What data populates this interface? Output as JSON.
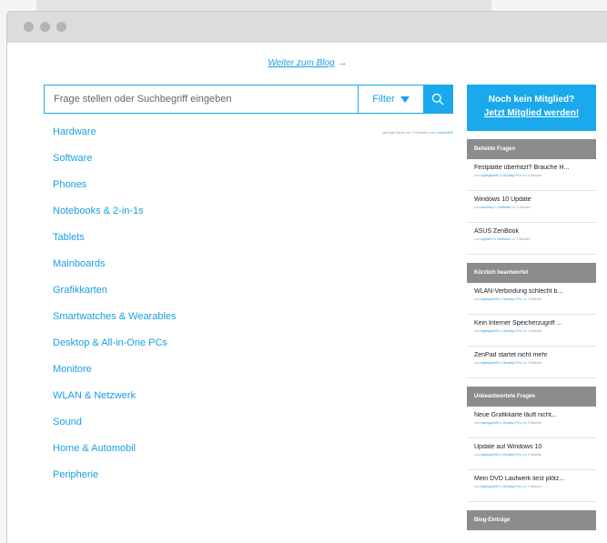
{
  "blog_link": "Weiter zum Blog",
  "search": {
    "placeholder": "Frage stellen oder Suchbegriff eingeben",
    "filter_label": "Filter"
  },
  "categories": [
    {
      "label": "Hardware",
      "meta_prefix": "gefragt Heute vor 3 Stunden von",
      "meta_user": "Louis1805"
    },
    {
      "label": "Software"
    },
    {
      "label": "Phones"
    },
    {
      "label": "Notebooks & 2-in-1s"
    },
    {
      "label": "Tablets"
    },
    {
      "label": "Mainboards"
    },
    {
      "label": "Grafikkarten"
    },
    {
      "label": "Smartwatches & Wearables"
    },
    {
      "label": "Desktop & All-in-One PCs"
    },
    {
      "label": "Monitore"
    },
    {
      "label": "WLAN & Netzwerk"
    },
    {
      "label": "Sound"
    },
    {
      "label": "Home & Automobil"
    },
    {
      "label": "Peripherie"
    }
  ],
  "sidebar": {
    "cta_title": "Noch kein Mitglied?",
    "cta_link": "Jetzt Mitglied werden!",
    "sections": [
      {
        "title": "Beliebte Fragen",
        "items": [
          {
            "q": "Festplatte überhitzt? Brauche H...",
            "by": "von",
            "user": "ostperguin55",
            "in": "in",
            "cat": "Desktop PCs",
            "time": "vor 3 Minuten"
          },
          {
            "q": "Windows 10 Update",
            "by": "von",
            "user": "pavShery",
            "in": "in",
            "cat": "Software",
            "time": "vor 3 Minuten"
          },
          {
            "q": "ASUS ZenBook",
            "by": "von",
            "user": "Agathers",
            "in": "in",
            "cat": "ZenBook",
            "time": "vor 3 Minuten"
          }
        ]
      },
      {
        "title": "Kürzlich beantwortet",
        "items": [
          {
            "q": "WLAN-Verbindung schlecht b...",
            "by": "von",
            "user": "ostperguin55",
            "in": "in",
            "cat": "Desktop PCs",
            "time": "vor 3 Minuten"
          },
          {
            "q": "Kein Interner Speicherzugriff ...",
            "by": "von",
            "user": "ostperguin55",
            "in": "in",
            "cat": "Desktop PCs",
            "time": "vor 3 Minuten"
          },
          {
            "q": "ZenPad startet nicht mehr",
            "by": "von",
            "user": "ostperguin55",
            "in": "in",
            "cat": "Desktop PCs",
            "time": "vor 3 Minuten"
          }
        ]
      },
      {
        "title": "Unbeantwortete Fragen",
        "items": [
          {
            "q": "Neue Grafikkarte läuft nicht...",
            "by": "von",
            "user": "ostperguin55",
            "in": "in",
            "cat": "Desktop PCs",
            "time": "vor 3 Minuten"
          },
          {
            "q": "Update auf Windows 10",
            "by": "von",
            "user": "ostperguin55",
            "in": "in",
            "cat": "Desktop PCs",
            "time": "vor 3 Minuten"
          },
          {
            "q": "Mein DVD Laufwerk liest plötz...",
            "by": "von",
            "user": "ostperguin55",
            "in": "in",
            "cat": "Desktop PCs",
            "time": "vor 3 Minuten"
          }
        ]
      },
      {
        "title": "Blog-Einträge",
        "items": []
      }
    ]
  },
  "colors": {
    "accent": "#1aa9ec",
    "sidebar_header": "#8c8c8c",
    "titlebar": "#dcdcdc"
  }
}
